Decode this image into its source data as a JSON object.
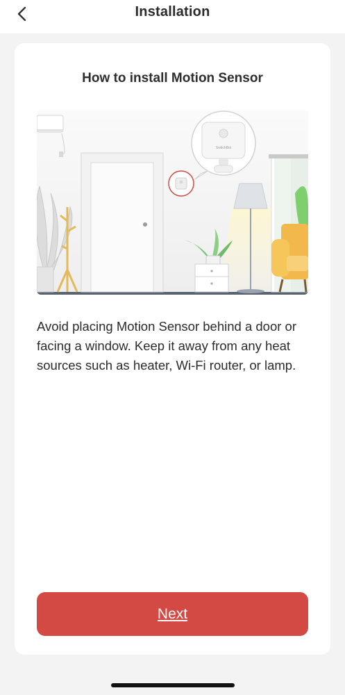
{
  "header": {
    "title": "Installation",
    "back_icon": "chevron-left-icon"
  },
  "card": {
    "title": "How to install Motion Sensor",
    "illustration": {
      "icon": "room-illustration",
      "device_brand": "SwitchBot"
    },
    "description": "Avoid placing Motion Sensor behind a door or facing a window. Keep it away from any heat sources such as heater, Wi-Fi router, or lamp."
  },
  "footer": {
    "next_label": "Next"
  },
  "colors": {
    "accent": "#d34943",
    "background": "#f3f3f3",
    "card": "#ffffff",
    "text": "#2b2b2b"
  }
}
